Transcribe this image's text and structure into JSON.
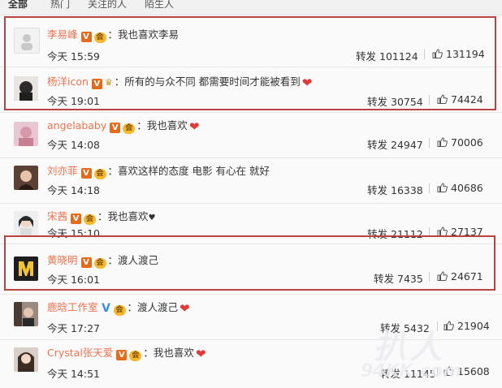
{
  "tabs": [
    {
      "label": "全部",
      "active": true
    },
    {
      "label": "热门",
      "active": false
    },
    {
      "label": "关注的人",
      "active": false
    },
    {
      "label": "陌生人",
      "active": false
    }
  ],
  "repost_label": "转发",
  "comments": [
    {
      "name": "李易峰",
      "badge": "V",
      "vip": "会",
      "text": "：我也喜欢李易",
      "emoji": "",
      "time": "今天 15:59",
      "reposts": "101124",
      "likes": "131194"
    },
    {
      "name": "杨洋icon",
      "badge": "V",
      "vip": "",
      "crown": "♛",
      "text": "：所有的与众不同 都需要时间才能被看到",
      "emoji": "heart",
      "time": "今天 19:01",
      "reposts": "30754",
      "likes": "74424"
    },
    {
      "name": "angelababy",
      "badge": "V",
      "vip": "会",
      "text": "：我也喜欢",
      "emoji": "heart",
      "time": "今天 14:08",
      "reposts": "24947",
      "likes": "70006"
    },
    {
      "name": "刘亦菲",
      "badge": "V",
      "vip": "会",
      "text": "：喜欢这样的态度 电影 有心在 就好",
      "emoji": "",
      "time": "今天 14:18",
      "reposts": "16338",
      "likes": "40686"
    },
    {
      "name": "宋茜",
      "badge": "V",
      "vip": "会",
      "text": "：我也喜欢",
      "emoji": "smallheart",
      "time": "今天 15:10",
      "reposts": "21112",
      "likes": "27137"
    },
    {
      "name": "黄晓明",
      "badge": "V",
      "vip": "会",
      "text": "：渡人渡己",
      "emoji": "",
      "time": "今天 16:01",
      "reposts": "7435",
      "likes": "24671"
    },
    {
      "name": "鹿晗工作室",
      "badge": "V",
      "badge_color": "blue",
      "vip": "会",
      "text": "：渡人渡己",
      "emoji": "heart",
      "time": "今天 17:27",
      "reposts": "5432",
      "likes": "21904"
    },
    {
      "name": "Crystal张天爱",
      "badge": "V",
      "vip": "会",
      "text": "：我也喜欢",
      "emoji": "heart",
      "time": "今天 14:51",
      "reposts": "11145",
      "likes": "15608"
    }
  ],
  "watermark": {
    "line1": "扒人",
    "line2": "94KK.com"
  },
  "colors": {
    "username": "#eb7350",
    "highlight": "#b8443f",
    "heart": "#e03a3a",
    "vip_badge": "#e56a19"
  },
  "icons": {
    "like": "thumbs-up-icon",
    "heart": "heart-emoji-icon"
  }
}
